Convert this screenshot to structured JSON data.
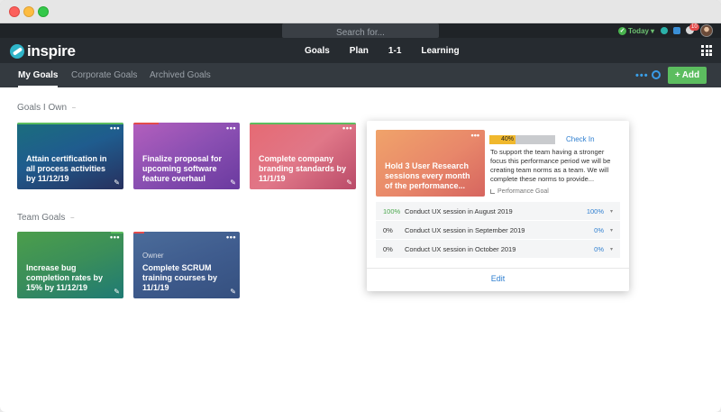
{
  "topbar": {
    "search_placeholder": "Search for...",
    "today_label": "Today",
    "notification_count": "10"
  },
  "brand": {
    "name": "inspire"
  },
  "main_nav": [
    {
      "label": "Goals"
    },
    {
      "label": "Plan"
    },
    {
      "label": "1-1"
    },
    {
      "label": "Learning"
    }
  ],
  "sub_nav": {
    "tabs": [
      {
        "label": "My Goals",
        "active": true
      },
      {
        "label": "Corporate Goals",
        "active": false
      },
      {
        "label": "Archived Goals",
        "active": false
      }
    ],
    "more_label": "•••",
    "add_label": "Add"
  },
  "sections": {
    "goals_i_own": {
      "title": "Goals I Own",
      "cards": [
        {
          "title": "Attain certification in all process activities by 11/12/19",
          "status_color": "#5cbd5f"
        },
        {
          "title": "Finalize proposal for upcoming software feature overhaul",
          "status_color": "#e34b4b"
        },
        {
          "title": "Complete company branding standards by 11/1/19",
          "status_color": "#5cbd5f"
        }
      ]
    },
    "team_goals": {
      "title": "Team Goals",
      "cards": [
        {
          "title": "Increase bug completion rates by 15% by 11/12/19",
          "status_color": "#5cbd5f",
          "owner": ""
        },
        {
          "title": "Complete SCRUM training courses by 11/1/19",
          "status_color": "#e34b4b",
          "owner": "Owner"
        }
      ]
    }
  },
  "popup": {
    "card_title": "Hold 3 User Research sessions every month of the performance...",
    "card_more": "•••",
    "progress_label": "40%",
    "progress_value": 40,
    "checkin_label": "Check In",
    "description": "To support the team having a stronger focus this performance period we will be creating team norms as a team. We will complete these norms to provide...",
    "goal_type": "Performance Goal",
    "key_results": [
      {
        "percent": "100%",
        "name": "Conduct UX session in August 2019",
        "value": "100%"
      },
      {
        "percent": "0%",
        "name": "Conduct UX session in September 2019",
        "value": "0%"
      },
      {
        "percent": "0%",
        "name": "Conduct UX session in October 2019",
        "value": "0%"
      }
    ],
    "edit_label": "Edit"
  },
  "colors": {
    "accent_blue": "#2f7fd0",
    "add_green": "#5cbd5f",
    "progress_yellow": "#f0b82d"
  }
}
